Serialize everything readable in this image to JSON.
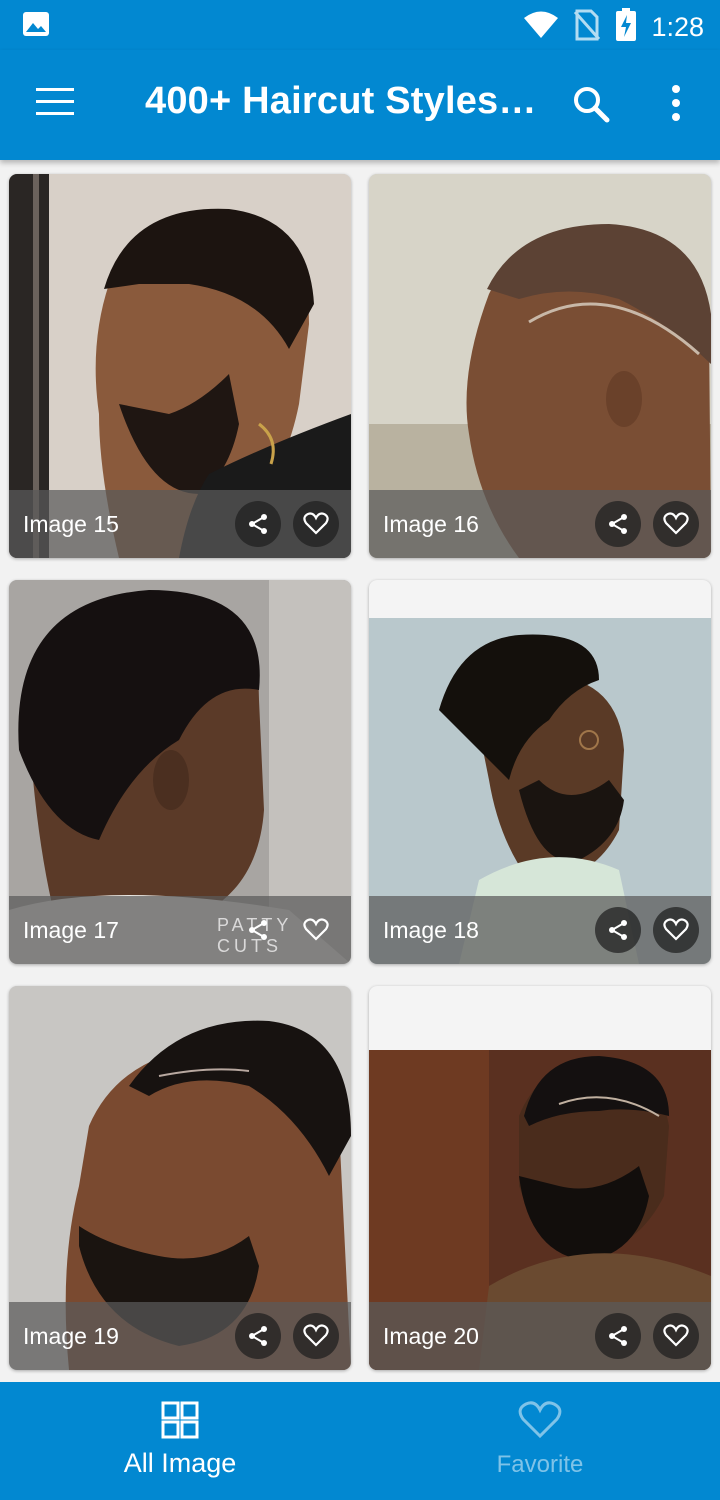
{
  "status_bar": {
    "time": "1:28",
    "icons": [
      "image-notification-icon",
      "wifi-icon",
      "no-sim-icon",
      "battery-charging-icon"
    ]
  },
  "app_bar": {
    "title": "400+ Haircut Styles…",
    "icons": [
      "menu-icon",
      "search-icon",
      "more-vert-icon"
    ]
  },
  "cards": [
    {
      "label": "Image 15"
    },
    {
      "label": "Image 16"
    },
    {
      "label": "Image 17",
      "watermark": "PATTY CUTS"
    },
    {
      "label": "Image 18"
    },
    {
      "label": "Image 19"
    },
    {
      "label": "Image 20"
    }
  ],
  "bottom_nav": [
    {
      "label": "All Image",
      "icon": "grid-icon",
      "active": true
    },
    {
      "label": "Favorite",
      "icon": "heart-outline-icon",
      "active": false
    }
  ],
  "colors": {
    "primary": "#0288d1",
    "inactive_nav": "#7fc3e8",
    "overlay": "#5a5a5a"
  }
}
